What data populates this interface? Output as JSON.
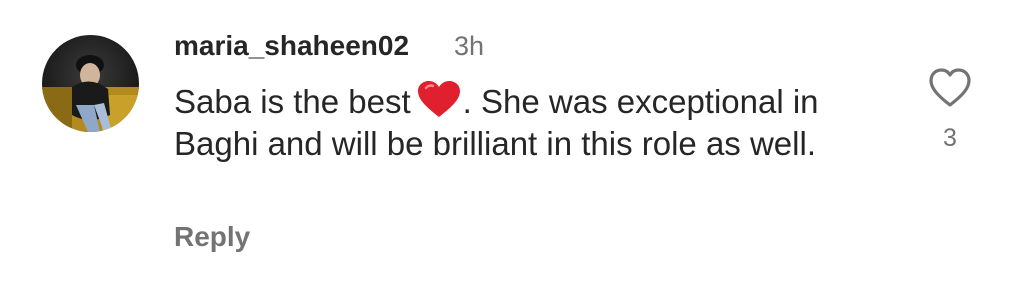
{
  "comment": {
    "username": "maria_shaheen02",
    "timestamp": "3h",
    "text_before_emoji": "Saba is the best",
    "emoji": "red-heart-emoji",
    "text_after_emoji": ". She was exceptional in Baghi and will be brilliant in this role as well.",
    "reply_label": "Reply",
    "like_count": "3",
    "like_icon": "heart-outline-icon"
  },
  "colors": {
    "primary_text": "#262626",
    "secondary_text": "#737373",
    "emoji_red": "#e0202e",
    "background": "#ffffff"
  }
}
